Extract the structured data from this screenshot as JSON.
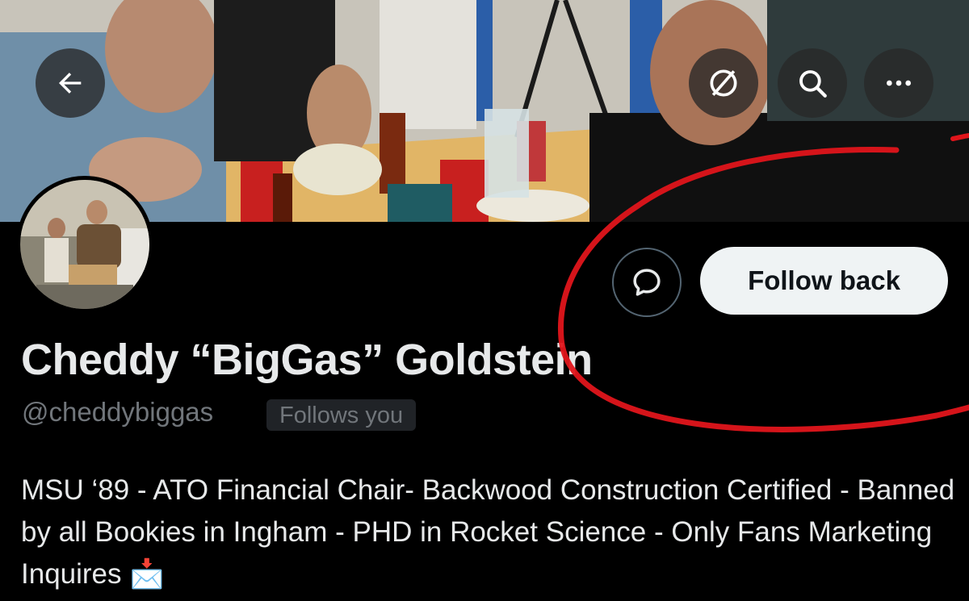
{
  "header": {
    "back_icon": "arrow-left-icon",
    "grok_icon": "grok-slash-circle-icon",
    "search_icon": "search-icon",
    "more_icon": "more-dots-icon"
  },
  "profile": {
    "display_name": "Cheddy “BigGas” Goldstein",
    "handle": "@cheddybiggas",
    "follows_you_badge": "Follows you",
    "bio": "MSU ‘89 - ATO Financial Chair- Backwood Construction Certified - Banned by all Bookies in Ingham - PHD in Rocket Science - Only Fans Marketing Inquires 📩"
  },
  "actions": {
    "message_icon": "message-bubble-icon",
    "follow_label": "Follow back"
  },
  "annotation": {
    "color": "#e0151b",
    "shape": "hand-drawn-ellipse"
  },
  "colors": {
    "background": "#000000",
    "text_primary": "#e7e9ea",
    "text_secondary": "#71767b",
    "follow_button_bg": "#eff3f4"
  }
}
